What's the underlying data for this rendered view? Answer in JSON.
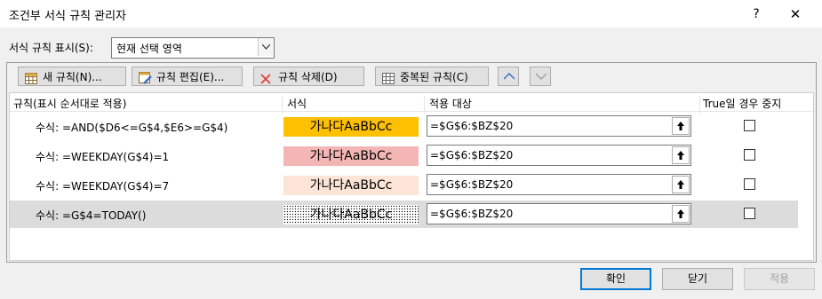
{
  "window": {
    "title": "조건부 서식 규칙 관리자",
    "help": "?",
    "close": "✕"
  },
  "show_rules": {
    "label": "서식 규칙 표시(S):",
    "selected": "현재 선택 영역"
  },
  "toolbar": {
    "new_rule": "새 규칙(N)...",
    "edit_rule": "규칙 편집(E)...",
    "delete_rule": "규칙 삭제(D)",
    "duplicate_rule": "중복된 규칙(C)"
  },
  "columns": [
    "규칙(표시 순서대로 적용)",
    "서식",
    "적용 대상",
    "True일 경우 중지"
  ],
  "rules": [
    {
      "rule": "수식: =AND($D6<=G$4,$E6>=G$4)",
      "preview": "가나다AaBbCc",
      "fill": "#FFC000",
      "applies_to": "=$G$6:$BZ$20",
      "stop_if_true": false
    },
    {
      "rule": "수식: =WEEKDAY(G$4)=1",
      "preview": "가나다AaBbCc",
      "fill": "#F4B6B4",
      "applies_to": "=$G$6:$BZ$20",
      "stop_if_true": false
    },
    {
      "rule": "수식: =WEEKDAY(G$4)=7",
      "preview": "가나다AaBbCc",
      "fill": "#FCE4D6",
      "applies_to": "=$G$6:$BZ$20",
      "stop_if_true": false
    },
    {
      "rule": "수식: =G$4=TODAY()",
      "preview": "가나다AaBbCc",
      "fill": "dotted",
      "applies_to": "=$G$6:$BZ$20",
      "stop_if_true": false,
      "selected": true
    }
  ],
  "buttons": {
    "ok": "확인",
    "close": "닫기",
    "apply": "적용"
  }
}
